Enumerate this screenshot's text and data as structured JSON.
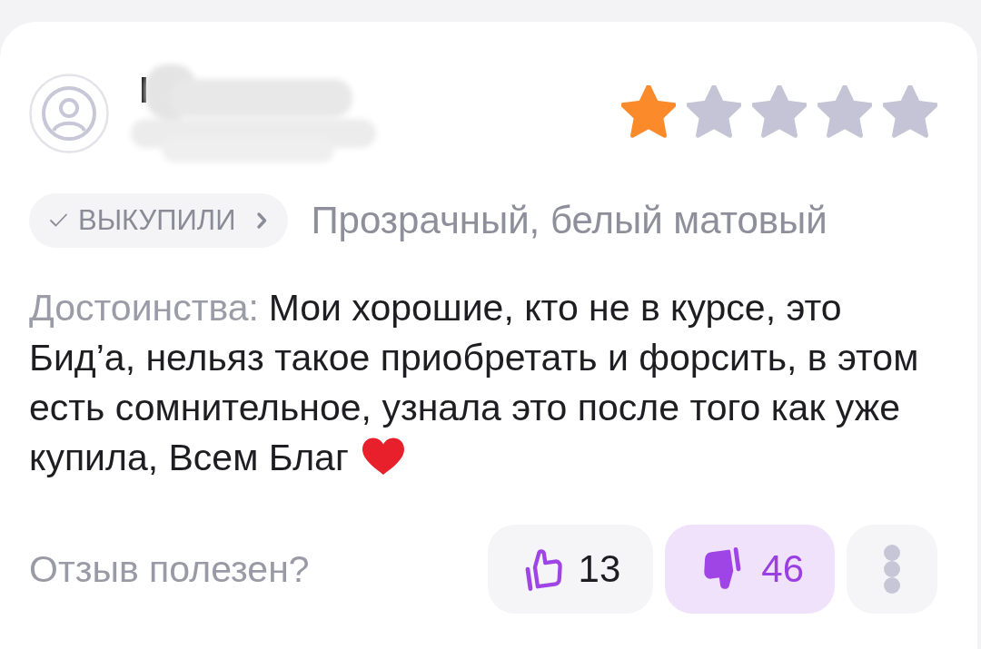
{
  "review": {
    "rating": {
      "stars": 1
    },
    "purchase_badge": {
      "label": "ВЫКУПИЛИ"
    },
    "variant": "Прозрачный, белый матовый",
    "pros": {
      "label": "Достоинства:",
      "text": "Мои хорошие, кто не в курсе, это Бид’а, нельяз такое приобретать и форсить, в этом есть сомнительное, узнала это после того как уже купила, Всем Благ"
    },
    "helpful": {
      "question": "Отзыв полезен?",
      "votes": [
        {
          "kind": "like",
          "count": "13",
          "selected": false
        },
        {
          "kind": "dislike",
          "count": "46",
          "selected": true
        }
      ]
    }
  }
}
